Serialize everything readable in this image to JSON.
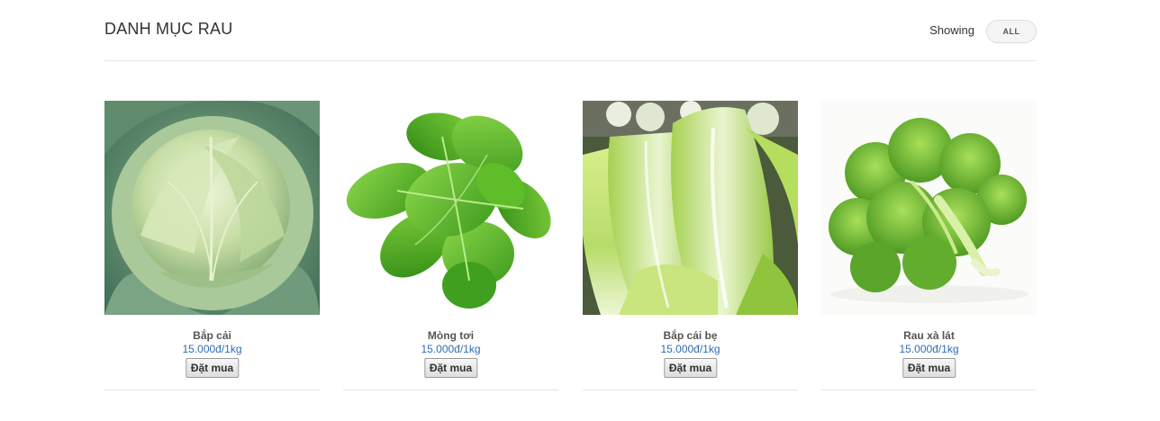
{
  "header": {
    "title": "DANH MỤC RAU",
    "showing_label": "Showing",
    "filter_label": "ALL"
  },
  "products": [
    {
      "name": "Bắp cải",
      "price": "15.000đ/1kg",
      "buy_label": "Đặt mua",
      "image_icon": "cabbage-image"
    },
    {
      "name": "Mòng tơi",
      "price": "15.000đ/1kg",
      "buy_label": "Đặt mua",
      "image_icon": "malabar-spinach-image"
    },
    {
      "name": "Bắp cải bẹ",
      "price": "15.000đ/1kg",
      "buy_label": "Đặt mua",
      "image_icon": "napa-cabbage-image"
    },
    {
      "name": "Rau xà lát",
      "price": "15.000đ/1kg",
      "buy_label": "Đặt mua",
      "image_icon": "lettuce-image"
    }
  ],
  "colors": {
    "price": "#2f6cb3",
    "leaf_green": "#5cb82e",
    "cabbage_pale": "#c9deb0"
  }
}
